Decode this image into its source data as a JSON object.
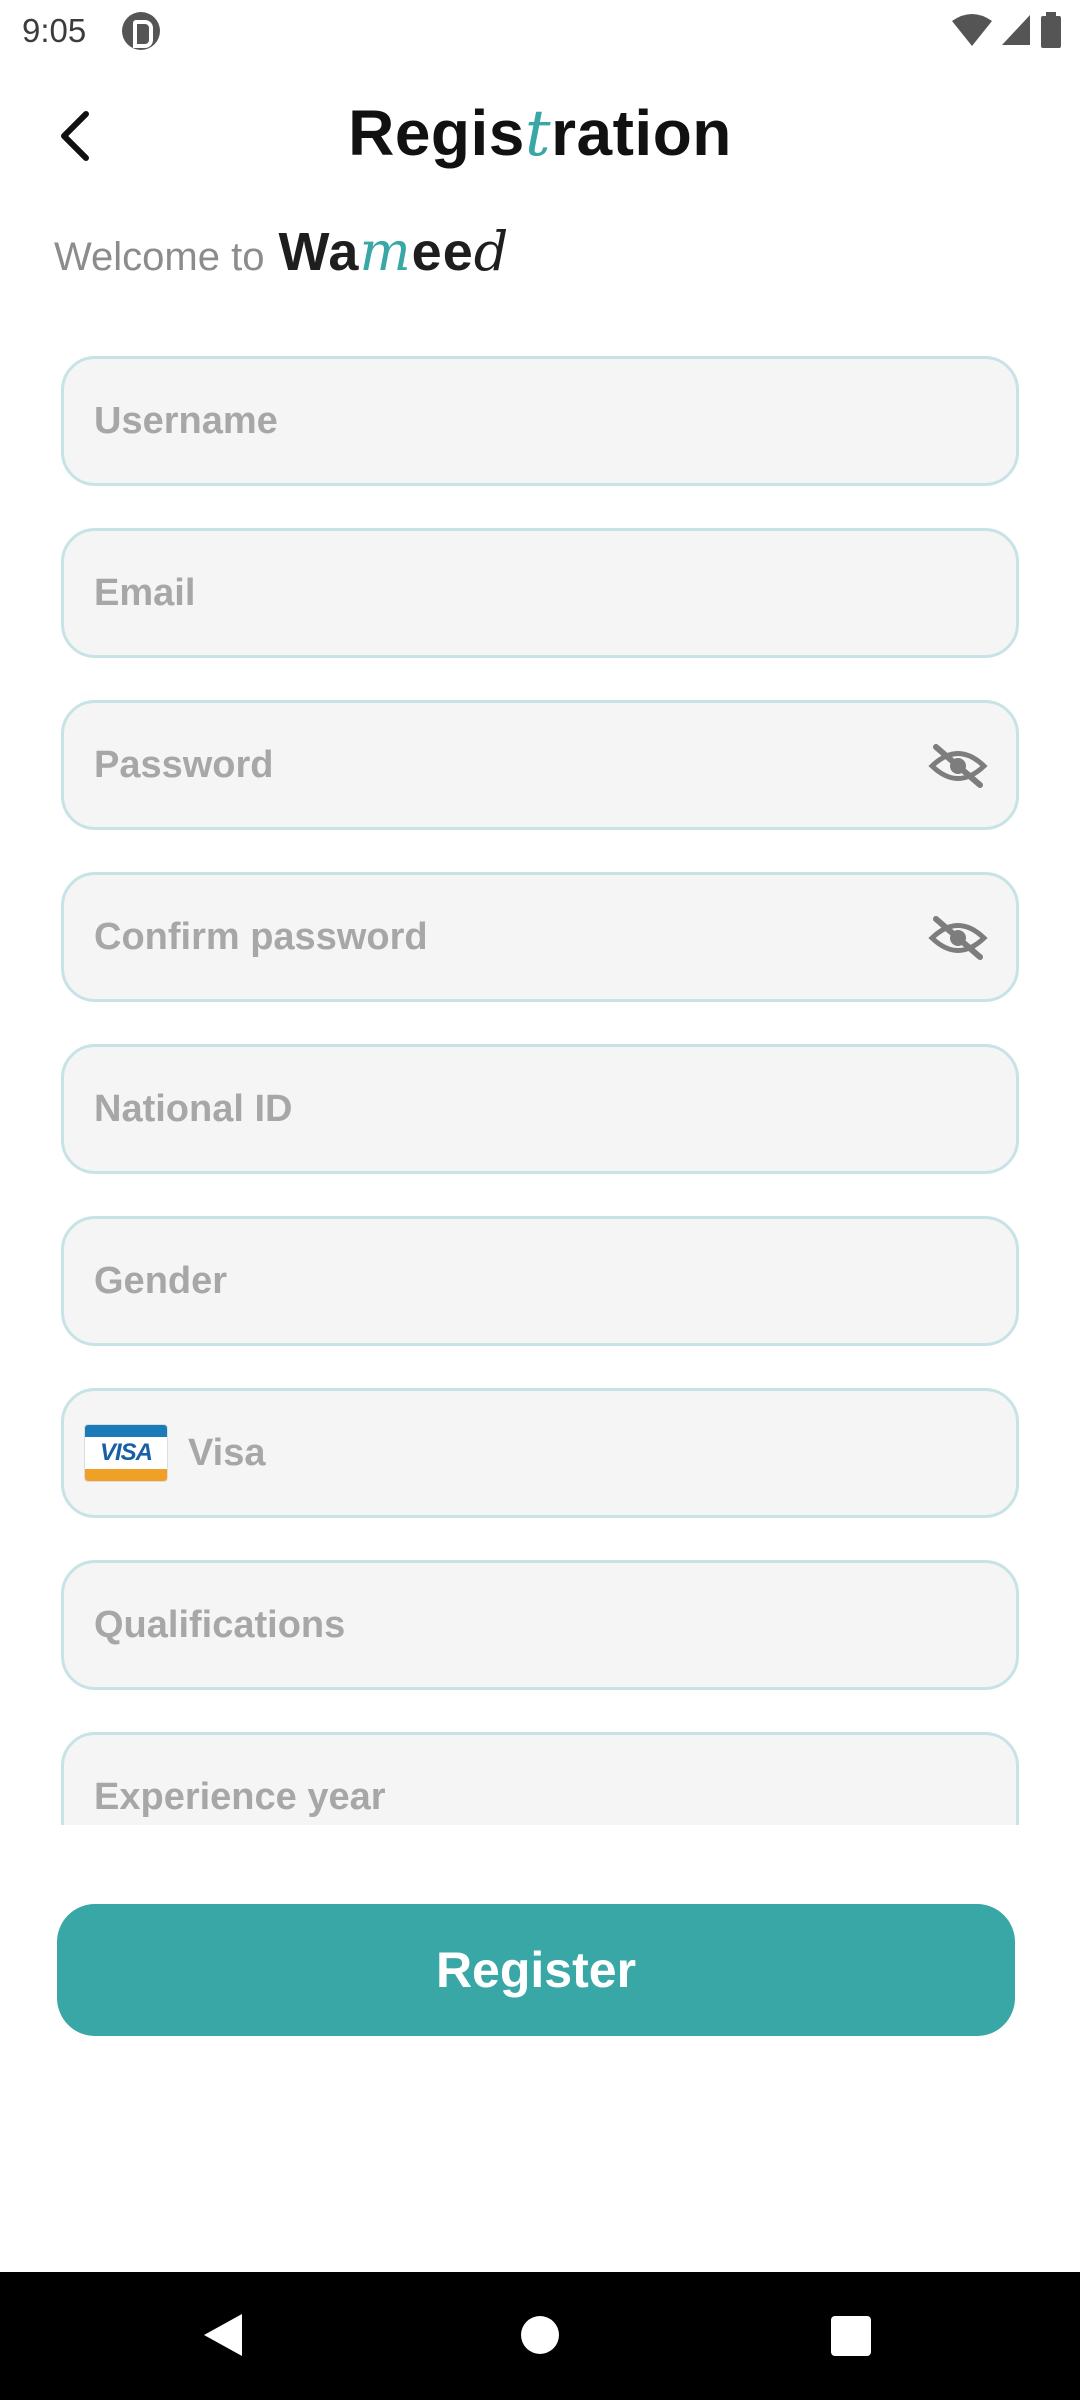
{
  "status_bar": {
    "time": "9:05"
  },
  "header": {
    "title_pre": "Regis",
    "title_accent": "t",
    "title_post": "ration"
  },
  "welcome": {
    "text": "Welcome to",
    "brand_pre": "Wa",
    "brand_m": "m",
    "brand_mid": "ee",
    "brand_d": "d"
  },
  "form": {
    "username_placeholder": "Username",
    "email_placeholder": "Email",
    "password_placeholder": "Password",
    "confirm_password_placeholder": "Confirm password",
    "national_id_placeholder": "National ID",
    "gender_placeholder": "Gender",
    "visa_placeholder": "Visa",
    "visa_card_text": "VISA",
    "qualifications_placeholder": "Qualifications",
    "experience_placeholder": "Experience year"
  },
  "actions": {
    "register_label": "Register"
  },
  "colors": {
    "accent": "#3aa7a7",
    "field_border": "#c7e3e6",
    "field_bg": "#f5f5f5",
    "placeholder": "#a7a7a7"
  },
  "icons": {
    "back": "arrow-left-icon",
    "eye": "eye-off-icon",
    "visa": "visa-card-icon",
    "wifi": "wifi-icon",
    "signal": "signal-icon",
    "battery": "battery-icon"
  }
}
